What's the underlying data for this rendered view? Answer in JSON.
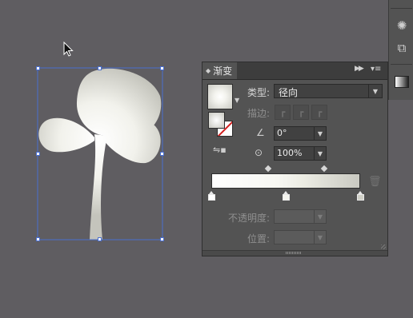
{
  "panel": {
    "tab_label": "渐变",
    "type_label": "类型:",
    "type_value": "径向",
    "stroke_label": "描边:",
    "angle_value": "0°",
    "aspect_value": "100%",
    "opacity_label": "不透明度:",
    "opacity_value": "",
    "location_label": "位置:",
    "location_value": "",
    "gradient_stops": [
      {
        "position_percent": 0,
        "color": "#ffffff"
      },
      {
        "position_percent": 50,
        "color": "#f4f4ee"
      },
      {
        "position_percent": 100,
        "color": "#cfcfc6"
      }
    ],
    "midpoints_percent": [
      38,
      76
    ]
  },
  "colors": {
    "canvas_bg": "#5f5d61",
    "panel_bg": "#535353",
    "selection_blue": "#4a6fd0",
    "stroke_none_red": "#d21f1f"
  },
  "icons": {
    "cursor": "arrow-pointer",
    "collapse": "double-chevron-right",
    "menu": "panel-menu",
    "reverse": "reverse-gradient",
    "angle": "angle",
    "aspect": "aspect-ratio",
    "delete": "trash"
  }
}
